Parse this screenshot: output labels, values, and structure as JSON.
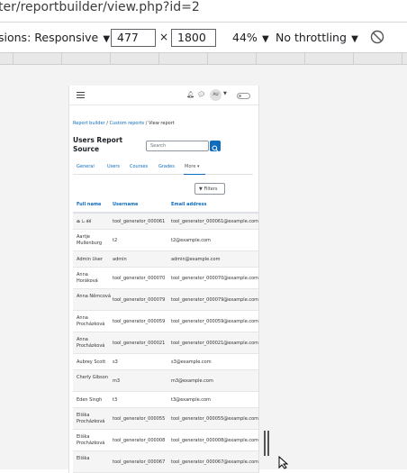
{
  "browser": {
    "url": "ter/reportbuilder/view.php?id=2"
  },
  "devtools": {
    "dimensions_label": "sions: Responsive",
    "width": "477",
    "times": "×",
    "height": "1800",
    "zoom": "44%",
    "throttling": "No throttling"
  },
  "page": {
    "avatar_initials": "AU",
    "breadcrumb": [
      "Report builder",
      "Custom reports",
      "View report"
    ],
    "breadcrumb_sep": "/",
    "title": "Users Report Source",
    "search_placeholder": "Search",
    "tabs": [
      "General",
      "Users",
      "Courses",
      "Grades",
      "More"
    ],
    "filters_label": "Filters",
    "columns": [
      "Full name",
      "Username",
      "Email address"
    ],
    "rows": [
      {
        "name": "ఉ ಓ శశ",
        "username": "tool_generator_000061",
        "email": "tool_generator_000061@example.com"
      },
      {
        "name": "Aartje Mullenburg",
        "username": "t2",
        "email": "t2@example.com"
      },
      {
        "name": "Admin User",
        "username": "admin",
        "email": "admin@example.com"
      },
      {
        "name": "Anna Horáková",
        "username": "tool_generator_000070",
        "email": "tool_generator_000070@example.com"
      },
      {
        "name": "Anna Němcová",
        "username": "tool_generator_000079",
        "email": "tool_generator_000079@example.com"
      },
      {
        "name": "Anna Procházková",
        "username": "tool_generator_000059",
        "email": "tool_generator_000059@example.com"
      },
      {
        "name": "Anna Procházková",
        "username": "tool_generator_000021",
        "email": "tool_generator_000021@example.com"
      },
      {
        "name": "Aubrey Scott",
        "username": "s3",
        "email": "s3@example.com"
      },
      {
        "name": "Cherly Gibson",
        "username": "m3",
        "email": "m3@example.com"
      },
      {
        "name": "Eden Singh",
        "username": "t3",
        "email": "t3@example.com"
      },
      {
        "name": "Eliška Procházková",
        "username": "tool_generator_000055",
        "email": "tool_generator_000055@example.com"
      },
      {
        "name": "Eliška Procházková",
        "username": "tool_generator_000008",
        "email": "tool_generator_000008@example.com"
      },
      {
        "name": "Eliška",
        "username": "tool_generator_000067",
        "email": "tool_generator_000067@example.com"
      }
    ]
  },
  "colors": {
    "link": "#0f6cbf",
    "primary_button": "#0f6cbf"
  }
}
